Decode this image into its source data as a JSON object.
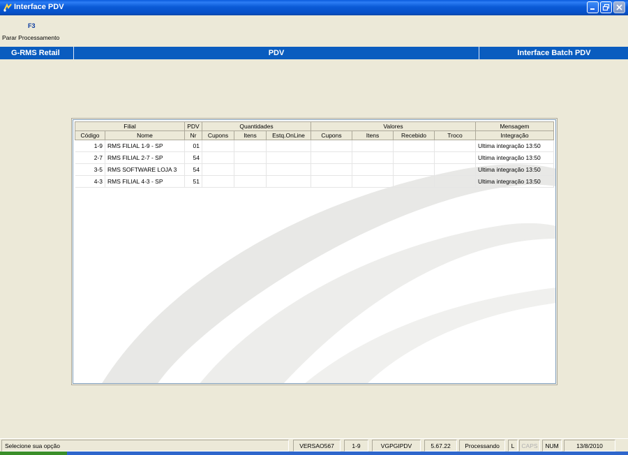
{
  "window": {
    "title": "Interface PDV",
    "icon": "app-icon",
    "controls": [
      "minimize-icon",
      "restore-icon",
      "close-icon"
    ]
  },
  "toolbar": {
    "key": "F3",
    "label": "Parar Processamento"
  },
  "header_band": {
    "left": "G-RMS Retail",
    "center": "PDV",
    "right": "Interface Batch PDV",
    "color": "#0a5cbf"
  },
  "grid": {
    "group_headers": [
      "Filial",
      "PDV",
      "Quantidades",
      "Valores",
      "Mensagem"
    ],
    "columns": [
      "Código",
      "Nome",
      "Nr",
      "Cupons",
      "Itens",
      "Estq.OnLine",
      "Cupons",
      "Itens",
      "Recebido",
      "Troco",
      "Integração"
    ],
    "rows": [
      {
        "codigo": "1-9",
        "nome": "RMS FILIAL 1-9 - SP",
        "nr": "01",
        "mensagem": "Ultima integração 13:50"
      },
      {
        "codigo": "2-7",
        "nome": "RMS FILIAL 2-7 - SP",
        "nr": "54",
        "mensagem": "Ultima integração 13:50"
      },
      {
        "codigo": "3-5",
        "nome": "RMS SOFTWARE LOJA 3",
        "nr": "54",
        "mensagem": "Ultima integração 13:50"
      },
      {
        "codigo": "4-3",
        "nome": "RMS FILIAL 4-3 - SP",
        "nr": "51",
        "mensagem": "Ultima integração 13:50"
      }
    ]
  },
  "statusbar": {
    "message": "Selecione sua opção",
    "version": "VERSAO567",
    "filial": "1-9",
    "program": "VGPGIPDV",
    "build": "5.67.22",
    "state": "Processando",
    "mode": "L",
    "caps": "CAPS",
    "num": "NUM",
    "date": "13/8/2010"
  }
}
